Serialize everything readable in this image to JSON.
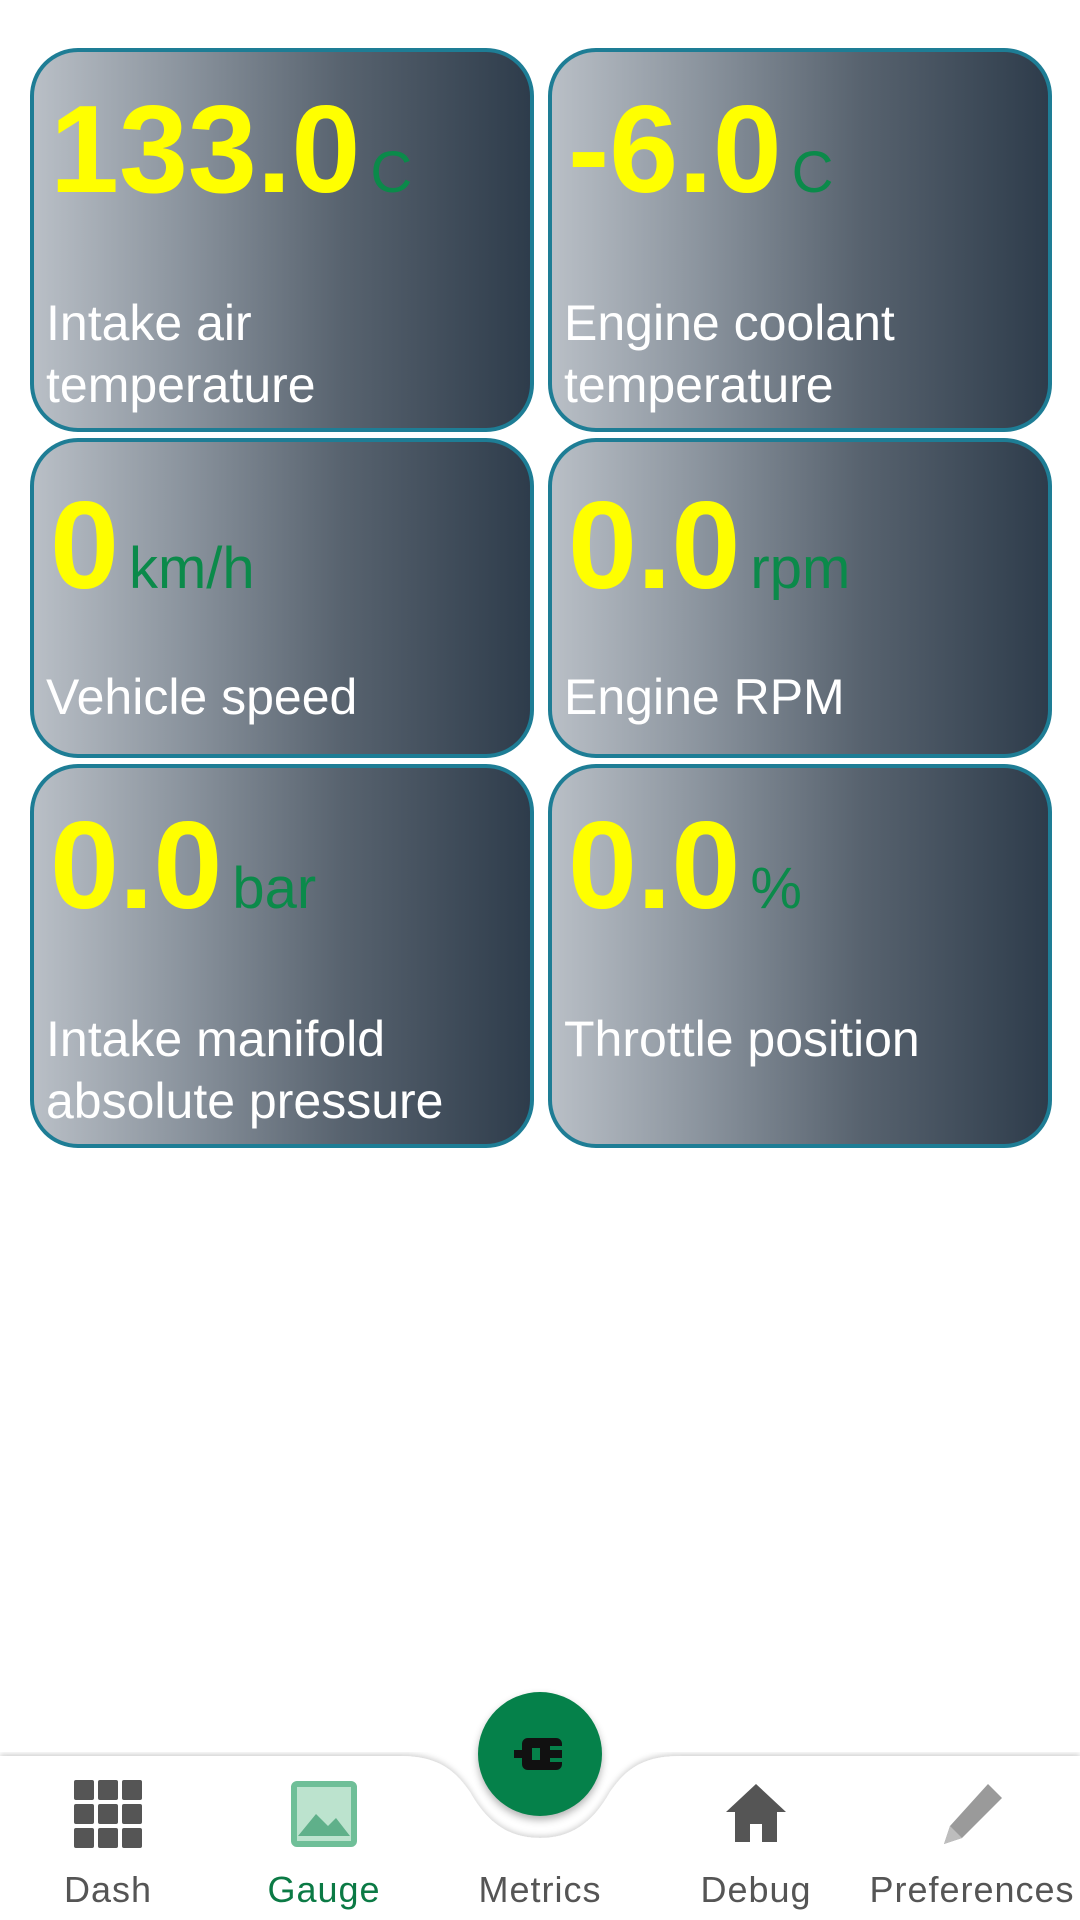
{
  "tiles": [
    {
      "value": "133.0",
      "unit": "C",
      "label": "Intake air temperature"
    },
    {
      "value": "-6.0",
      "unit": "C",
      "label": "Engine coolant temperature"
    },
    {
      "value": "0",
      "unit": "km/h",
      "label": "Vehicle speed"
    },
    {
      "value": "0.0",
      "unit": "rpm",
      "label": "Engine RPM"
    },
    {
      "value": "0.0",
      "unit": "bar",
      "label": "Intake manifold absolute pressure"
    },
    {
      "value": "0.0",
      "unit": "%",
      "label": "Throttle position"
    }
  ],
  "nav": {
    "items": [
      {
        "label": "Dash",
        "icon": "grid-icon",
        "active": false
      },
      {
        "label": "Gauge",
        "icon": "image-icon",
        "active": true
      },
      {
        "label": "Metrics",
        "icon": "connector-icon",
        "active": false
      },
      {
        "label": "Debug",
        "icon": "home-icon",
        "active": false
      },
      {
        "label": "Preferences",
        "icon": "pencil-icon",
        "active": false
      }
    ]
  },
  "colors": {
    "value": "#ffff00",
    "unit": "#0b8a4a",
    "border": "#1e7d95",
    "accent": "#05814a",
    "nav_inactive": "#555555",
    "nav_active": "#0b7a45"
  }
}
